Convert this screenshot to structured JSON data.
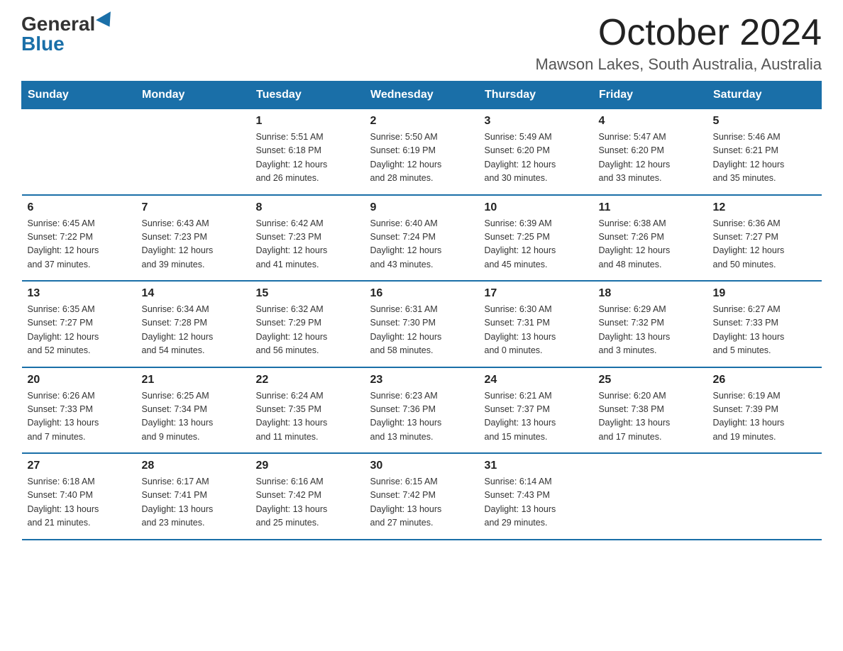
{
  "logo": {
    "general": "General",
    "blue": "Blue"
  },
  "title": {
    "month_year": "October 2024",
    "location": "Mawson Lakes, South Australia, Australia"
  },
  "weekdays": [
    "Sunday",
    "Monday",
    "Tuesday",
    "Wednesday",
    "Thursday",
    "Friday",
    "Saturday"
  ],
  "weeks": [
    [
      {
        "day": "",
        "info": ""
      },
      {
        "day": "",
        "info": ""
      },
      {
        "day": "1",
        "info": "Sunrise: 5:51 AM\nSunset: 6:18 PM\nDaylight: 12 hours\nand 26 minutes."
      },
      {
        "day": "2",
        "info": "Sunrise: 5:50 AM\nSunset: 6:19 PM\nDaylight: 12 hours\nand 28 minutes."
      },
      {
        "day": "3",
        "info": "Sunrise: 5:49 AM\nSunset: 6:20 PM\nDaylight: 12 hours\nand 30 minutes."
      },
      {
        "day": "4",
        "info": "Sunrise: 5:47 AM\nSunset: 6:20 PM\nDaylight: 12 hours\nand 33 minutes."
      },
      {
        "day": "5",
        "info": "Sunrise: 5:46 AM\nSunset: 6:21 PM\nDaylight: 12 hours\nand 35 minutes."
      }
    ],
    [
      {
        "day": "6",
        "info": "Sunrise: 6:45 AM\nSunset: 7:22 PM\nDaylight: 12 hours\nand 37 minutes."
      },
      {
        "day": "7",
        "info": "Sunrise: 6:43 AM\nSunset: 7:23 PM\nDaylight: 12 hours\nand 39 minutes."
      },
      {
        "day": "8",
        "info": "Sunrise: 6:42 AM\nSunset: 7:23 PM\nDaylight: 12 hours\nand 41 minutes."
      },
      {
        "day": "9",
        "info": "Sunrise: 6:40 AM\nSunset: 7:24 PM\nDaylight: 12 hours\nand 43 minutes."
      },
      {
        "day": "10",
        "info": "Sunrise: 6:39 AM\nSunset: 7:25 PM\nDaylight: 12 hours\nand 45 minutes."
      },
      {
        "day": "11",
        "info": "Sunrise: 6:38 AM\nSunset: 7:26 PM\nDaylight: 12 hours\nand 48 minutes."
      },
      {
        "day": "12",
        "info": "Sunrise: 6:36 AM\nSunset: 7:27 PM\nDaylight: 12 hours\nand 50 minutes."
      }
    ],
    [
      {
        "day": "13",
        "info": "Sunrise: 6:35 AM\nSunset: 7:27 PM\nDaylight: 12 hours\nand 52 minutes."
      },
      {
        "day": "14",
        "info": "Sunrise: 6:34 AM\nSunset: 7:28 PM\nDaylight: 12 hours\nand 54 minutes."
      },
      {
        "day": "15",
        "info": "Sunrise: 6:32 AM\nSunset: 7:29 PM\nDaylight: 12 hours\nand 56 minutes."
      },
      {
        "day": "16",
        "info": "Sunrise: 6:31 AM\nSunset: 7:30 PM\nDaylight: 12 hours\nand 58 minutes."
      },
      {
        "day": "17",
        "info": "Sunrise: 6:30 AM\nSunset: 7:31 PM\nDaylight: 13 hours\nand 0 minutes."
      },
      {
        "day": "18",
        "info": "Sunrise: 6:29 AM\nSunset: 7:32 PM\nDaylight: 13 hours\nand 3 minutes."
      },
      {
        "day": "19",
        "info": "Sunrise: 6:27 AM\nSunset: 7:33 PM\nDaylight: 13 hours\nand 5 minutes."
      }
    ],
    [
      {
        "day": "20",
        "info": "Sunrise: 6:26 AM\nSunset: 7:33 PM\nDaylight: 13 hours\nand 7 minutes."
      },
      {
        "day": "21",
        "info": "Sunrise: 6:25 AM\nSunset: 7:34 PM\nDaylight: 13 hours\nand 9 minutes."
      },
      {
        "day": "22",
        "info": "Sunrise: 6:24 AM\nSunset: 7:35 PM\nDaylight: 13 hours\nand 11 minutes."
      },
      {
        "day": "23",
        "info": "Sunrise: 6:23 AM\nSunset: 7:36 PM\nDaylight: 13 hours\nand 13 minutes."
      },
      {
        "day": "24",
        "info": "Sunrise: 6:21 AM\nSunset: 7:37 PM\nDaylight: 13 hours\nand 15 minutes."
      },
      {
        "day": "25",
        "info": "Sunrise: 6:20 AM\nSunset: 7:38 PM\nDaylight: 13 hours\nand 17 minutes."
      },
      {
        "day": "26",
        "info": "Sunrise: 6:19 AM\nSunset: 7:39 PM\nDaylight: 13 hours\nand 19 minutes."
      }
    ],
    [
      {
        "day": "27",
        "info": "Sunrise: 6:18 AM\nSunset: 7:40 PM\nDaylight: 13 hours\nand 21 minutes."
      },
      {
        "day": "28",
        "info": "Sunrise: 6:17 AM\nSunset: 7:41 PM\nDaylight: 13 hours\nand 23 minutes."
      },
      {
        "day": "29",
        "info": "Sunrise: 6:16 AM\nSunset: 7:42 PM\nDaylight: 13 hours\nand 25 minutes."
      },
      {
        "day": "30",
        "info": "Sunrise: 6:15 AM\nSunset: 7:42 PM\nDaylight: 13 hours\nand 27 minutes."
      },
      {
        "day": "31",
        "info": "Sunrise: 6:14 AM\nSunset: 7:43 PM\nDaylight: 13 hours\nand 29 minutes."
      },
      {
        "day": "",
        "info": ""
      },
      {
        "day": "",
        "info": ""
      }
    ]
  ]
}
